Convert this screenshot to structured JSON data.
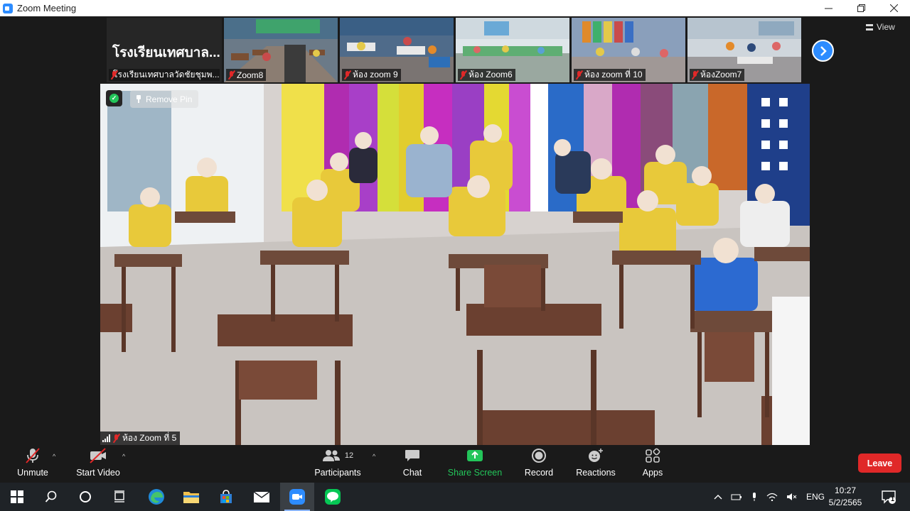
{
  "window": {
    "title": "Zoom Meeting",
    "minimize_icon": "minimize-icon",
    "restore_icon": "restore-icon",
    "close_icon": "close-icon"
  },
  "gallery_strip": {
    "name_tile": {
      "big_name": "โรงเรียนเทศบาล...",
      "label": "โรงเรียนเทศบาลวัดชัยชุมพ..."
    },
    "tiles": [
      {
        "label": "Zoom8"
      },
      {
        "label": "ห้อง zoom 9"
      },
      {
        "label": "ห้อง Zoom6"
      },
      {
        "label": "ห้อง zoom ที่ 10"
      },
      {
        "label": "ห้องZoom7"
      }
    ],
    "next_icon": "chevron-right-icon",
    "view_label": "View"
  },
  "main_video": {
    "remove_pin_label": "Remove Pin",
    "participant_label": "ห้อง Zoom ที่ 5",
    "security_icon": "shield-check-icon"
  },
  "toolbar": {
    "unmute_label": "Unmute",
    "start_video_label": "Start Video",
    "participants_label": "Participants",
    "participants_count": "12",
    "chat_label": "Chat",
    "share_screen_label": "Share Screen",
    "record_label": "Record",
    "reactions_label": "Reactions",
    "apps_label": "Apps",
    "leave_label": "Leave",
    "accent_green": "#23c55a",
    "leave_red": "#e02828"
  },
  "taskbar": {
    "language": "ENG",
    "time": "10:27",
    "date": "5/2/2565",
    "notification_count": "1",
    "apps": [
      "windows-start-icon",
      "search-icon",
      "cortana-icon",
      "task-view-icon",
      "edge-icon",
      "file-explorer-icon",
      "store-icon",
      "mail-icon",
      "zoom-icon",
      "line-icon"
    ]
  }
}
